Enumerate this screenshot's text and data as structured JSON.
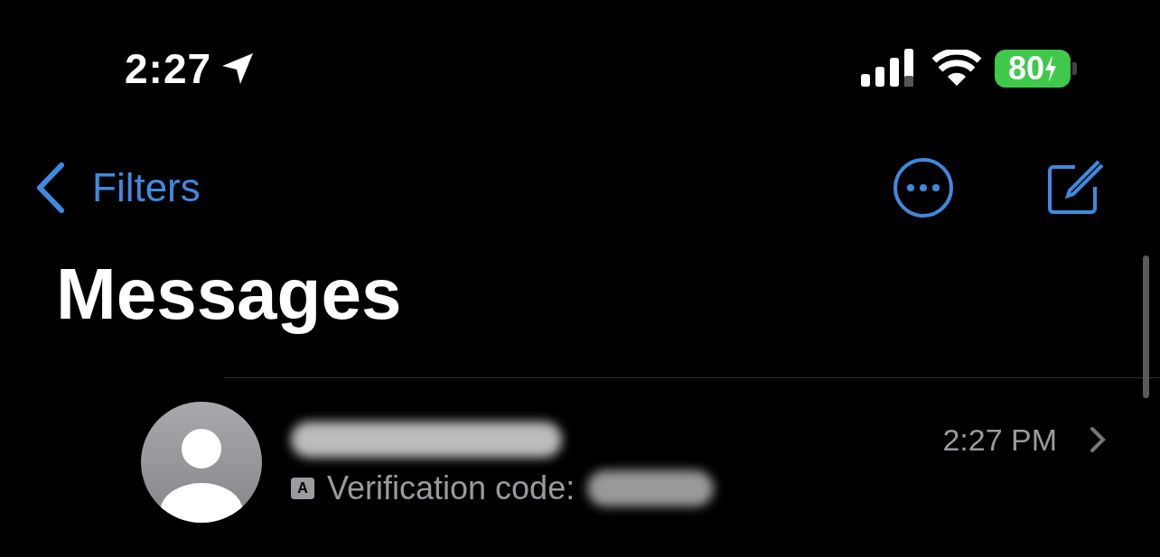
{
  "status_bar": {
    "time": "2:27",
    "location_active": true,
    "battery": {
      "text": "80",
      "charging": true
    }
  },
  "nav_bar": {
    "back_label": "Filters"
  },
  "title": "Messages",
  "conversations": [
    {
      "sender_redacted": true,
      "time": "2:27 PM",
      "badge": "A",
      "preview": "Verification code:",
      "preview_redacted": true
    }
  ]
}
